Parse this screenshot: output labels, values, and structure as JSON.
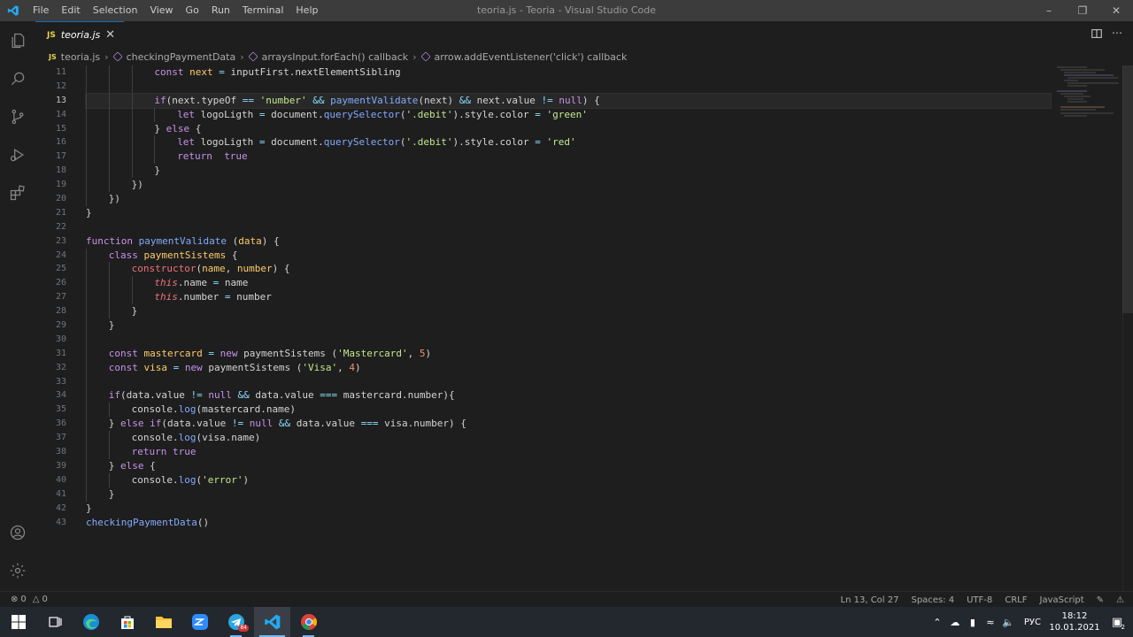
{
  "window": {
    "title": "teoria.js - Teoria - Visual Studio Code",
    "menu": [
      "File",
      "Edit",
      "Selection",
      "View",
      "Go",
      "Run",
      "Terminal",
      "Help"
    ]
  },
  "tabs": [
    {
      "lang": "JS",
      "label": "teoria.js",
      "active": true
    }
  ],
  "breadcrumb": {
    "lang": "JS",
    "file": "teoria.js",
    "items": [
      "checkingPaymentData",
      "arraysInput.forEach() callback",
      "arrow.addEventListener('click') callback"
    ]
  },
  "editor": {
    "active_line": 13,
    "line_numbers": [
      "11",
      "12",
      "13",
      "14",
      "15",
      "16",
      "17",
      "18",
      "19",
      "20",
      "21",
      "22",
      "23",
      "24",
      "25",
      "26",
      "27",
      "28",
      "29",
      "30",
      "31",
      "32",
      "33",
      "34",
      "35",
      "36",
      "37",
      "38",
      "39",
      "40",
      "41",
      "42",
      "43"
    ]
  },
  "status": {
    "errors": "0",
    "warnings": "0",
    "position": "Ln 13, Col 27",
    "spaces": "Spaces: 4",
    "encoding": "UTF-8",
    "eol": "CRLF",
    "language": "JavaScript"
  },
  "taskbar": {
    "telegram_badge": "84",
    "lang_indicator": "РУС",
    "time": "18:12",
    "date": "10.01.2021",
    "notifications": "2"
  },
  "colors": {
    "accent": "#0e70c0",
    "editor_bg": "#1e1e1e",
    "keyword": "#f07178",
    "function": "#82aaff",
    "string": "#c3e88d",
    "number": "#f78c6c"
  }
}
